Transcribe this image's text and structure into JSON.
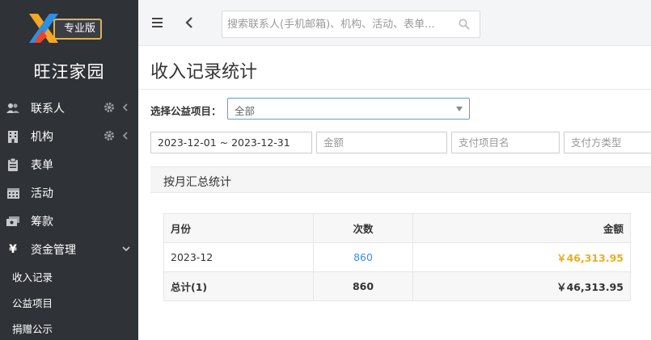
{
  "sidebar": {
    "badge": "专业版",
    "site_title": "旺汪家园",
    "items": [
      {
        "label": "联系人",
        "icon": "users-icon"
      },
      {
        "label": "机构",
        "icon": "building-icon"
      },
      {
        "label": "表单",
        "icon": "clipboard-icon"
      },
      {
        "label": "活动",
        "icon": "calendar-icon"
      },
      {
        "label": "筹款",
        "icon": "money-icon"
      },
      {
        "label": "资金管理",
        "icon": "yen-icon"
      }
    ],
    "sub_items": [
      "收入记录",
      "公益项目",
      "捐赠公示"
    ]
  },
  "topbar": {
    "search_placeholder": "搜索联系人(手机邮箱)、机构、活动、表单..."
  },
  "page": {
    "title": "收入记录统计",
    "project_label": "选择公益项目：",
    "project_value": "全部"
  },
  "filters": {
    "date_range": "2023-12-01 ~ 2023-12-31",
    "amount_placeholder": "金额",
    "item_name_placeholder": "支付项目名",
    "pay_type_placeholder": "支付方类型"
  },
  "panel": {
    "title": "按月汇总统计",
    "columns": [
      "月份",
      "次数",
      "金额"
    ],
    "rows": [
      {
        "month": "2023-12",
        "count": "860",
        "amount": "￥46,313.95"
      }
    ],
    "total": {
      "label": "总计(1)",
      "count": "860",
      "amount": "￥46,313.95"
    }
  },
  "colors": {
    "sidebar_bg": "#2f3237",
    "accent_gold": "#f0ad1e",
    "link_blue": "#3a8ee6",
    "badge_border": "#d7b45a"
  }
}
